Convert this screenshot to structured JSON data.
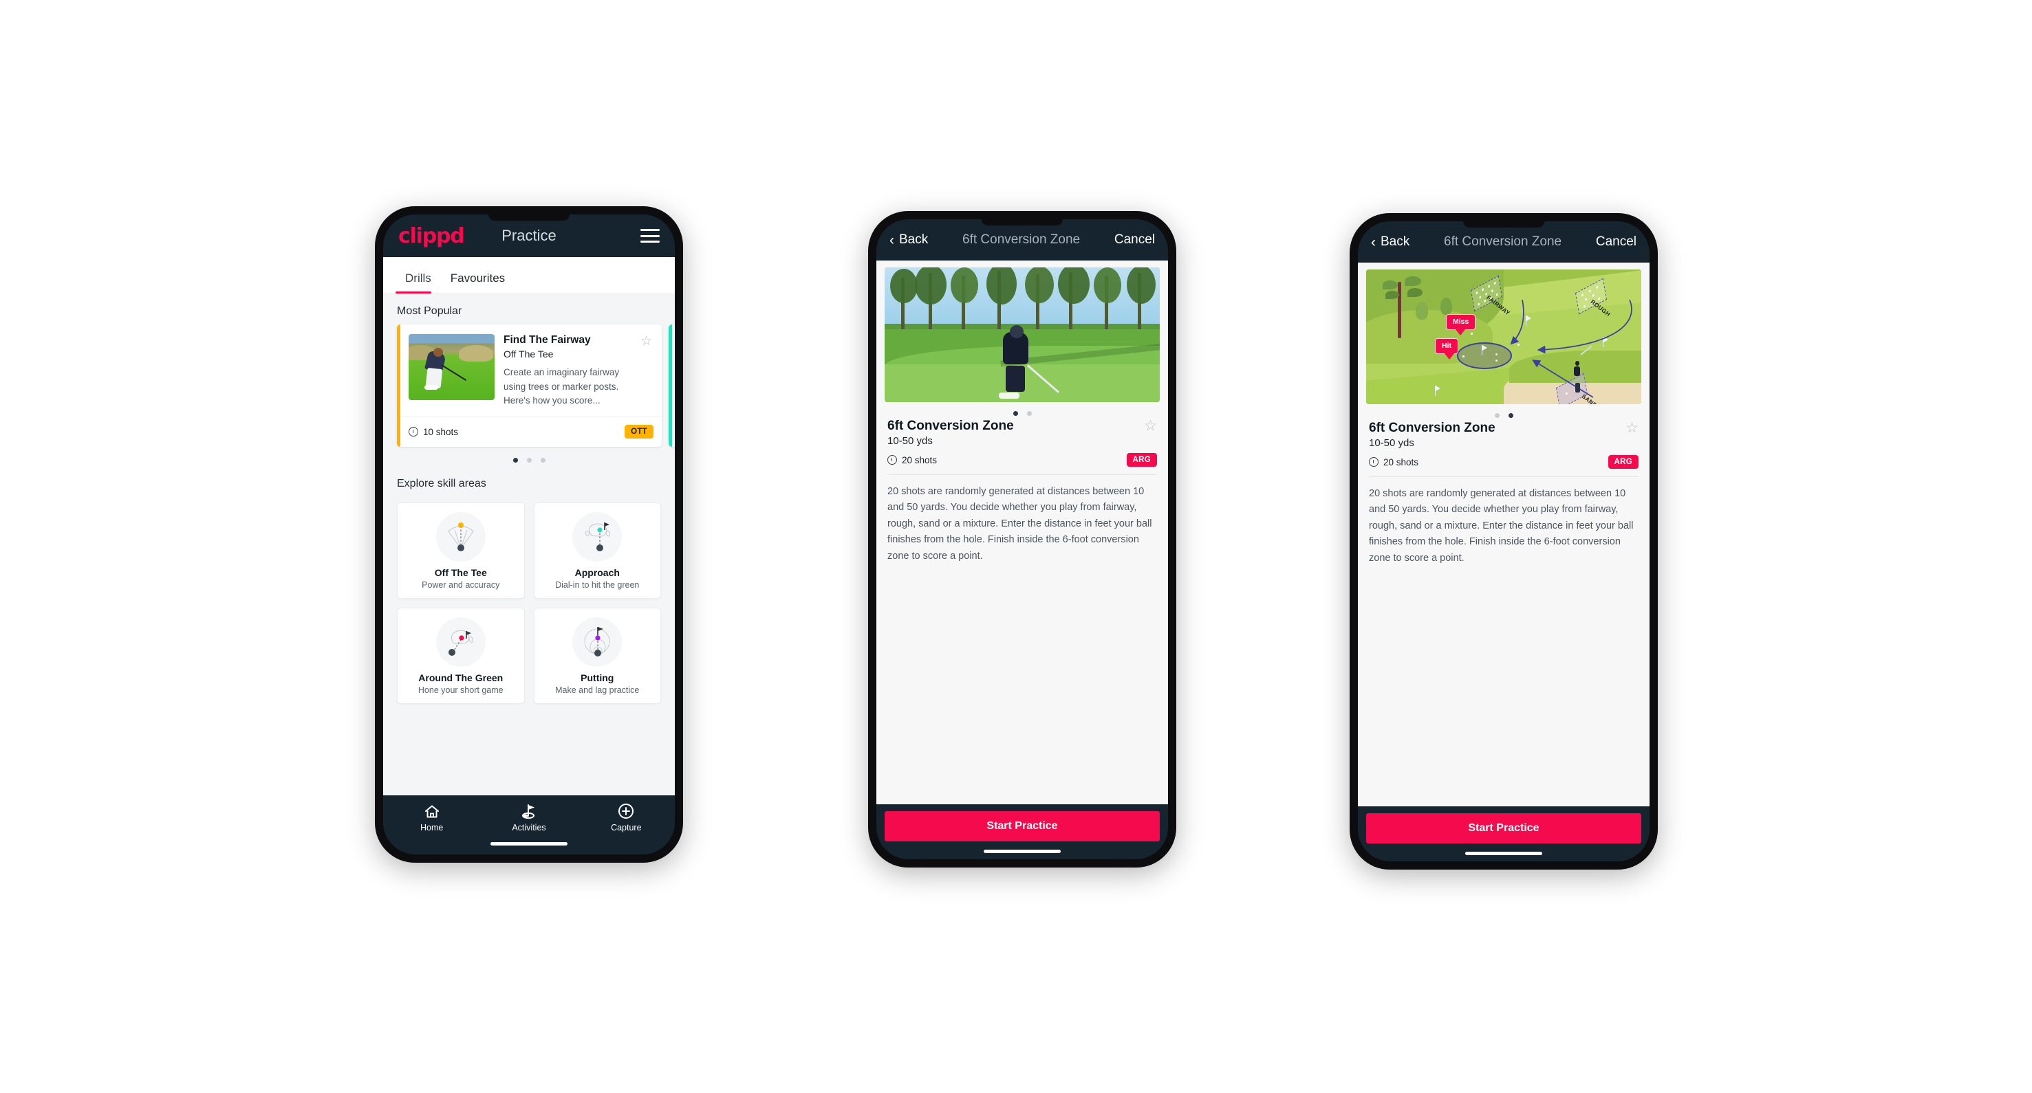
{
  "phone1": {
    "topbar": {
      "logo": "clippd",
      "title": "Practice",
      "menu_icon": "hamburger-icon"
    },
    "tabs": [
      {
        "label": "Drills",
        "active": true
      },
      {
        "label": "Favourites",
        "active": false
      }
    ],
    "sections": {
      "most_popular": "Most Popular",
      "explore": "Explore skill areas"
    },
    "drill_card": {
      "title": "Find The Fairway",
      "subtitle": "Off The Tee",
      "description": "Create an imaginary fairway using trees or marker posts. Here's how you score...",
      "shots": "10 shots",
      "badge": "OTT",
      "badge_color": "#ffb300",
      "accent_color": "#ffb300",
      "star_icon": "star-outline-icon",
      "clock_icon": "clock-icon"
    },
    "carousel_dots": {
      "count": 3,
      "active": 0
    },
    "skill_areas": [
      {
        "name": "Off The Tee",
        "desc": "Power and accuracy",
        "icon": "tee-fan-icon",
        "dot_color": "#ffb300"
      },
      {
        "name": "Approach",
        "desc": "Dial-in to hit the green",
        "icon": "approach-green-icon",
        "dot_color": "#2bdbc0"
      },
      {
        "name": "Around The Green",
        "desc": "Hone your short game",
        "icon": "around-green-icon",
        "dot_color": "#f50a4d"
      },
      {
        "name": "Putting",
        "desc": "Make and lag practice",
        "icon": "putting-rings-icon",
        "dot_color": "#9b1fe0"
      }
    ],
    "nav": [
      {
        "label": "Home",
        "icon": "home-icon",
        "active": false
      },
      {
        "label": "Activities",
        "icon": "golf-flag-icon",
        "active": true
      },
      {
        "label": "Capture",
        "icon": "plus-circle-icon",
        "active": false
      }
    ]
  },
  "phone2": {
    "topbar": {
      "back": "Back",
      "title": "6ft Conversion Zone",
      "cancel": "Cancel",
      "back_icon": "chevron-left-icon"
    },
    "media": {
      "type": "photo",
      "alt": "golfer-chipping-photo"
    },
    "carousel_dots": {
      "count": 2,
      "active": 0
    },
    "detail": {
      "title": "6ft Conversion Zone",
      "yardage": "10-50 yds",
      "shots": "20 shots",
      "badge": "ARG",
      "badge_color": "#f50a4d",
      "star_icon": "star-outline-icon",
      "clock_icon": "clock-icon",
      "description": "20 shots are randomly generated at distances between 10 and 50 yards. You decide whether you play from fairway, rough, sand or a mixture. Enter the distance in feet your ball finishes from the hole. Finish inside the 6-foot conversion zone to score a point."
    },
    "footer": {
      "start_label": "Start Practice",
      "start_color": "#f50a4d"
    }
  },
  "phone3": {
    "topbar": {
      "back": "Back",
      "title": "6ft Conversion Zone",
      "cancel": "Cancel",
      "back_icon": "chevron-left-icon"
    },
    "media": {
      "type": "illustration",
      "alt": "golf-course-diagram",
      "zone_labels": [
        "FAIRWAY",
        "ROUGH",
        "SAND"
      ],
      "callouts": [
        "Miss",
        "Hit"
      ],
      "callout_color": "#f50a4d"
    },
    "carousel_dots": {
      "count": 2,
      "active": 1
    },
    "detail": {
      "title": "6ft Conversion Zone",
      "yardage": "10-50 yds",
      "shots": "20 shots",
      "badge": "ARG",
      "badge_color": "#f50a4d",
      "star_icon": "star-outline-icon",
      "clock_icon": "clock-icon",
      "description": "20 shots are randomly generated at distances between 10 and 50 yards. You decide whether you play from fairway, rough, sand or a mixture. Enter the distance in feet your ball finishes from the hole. Finish inside the 6-foot conversion zone to score a point."
    },
    "footer": {
      "start_label": "Start Practice",
      "start_color": "#f50a4d"
    }
  }
}
